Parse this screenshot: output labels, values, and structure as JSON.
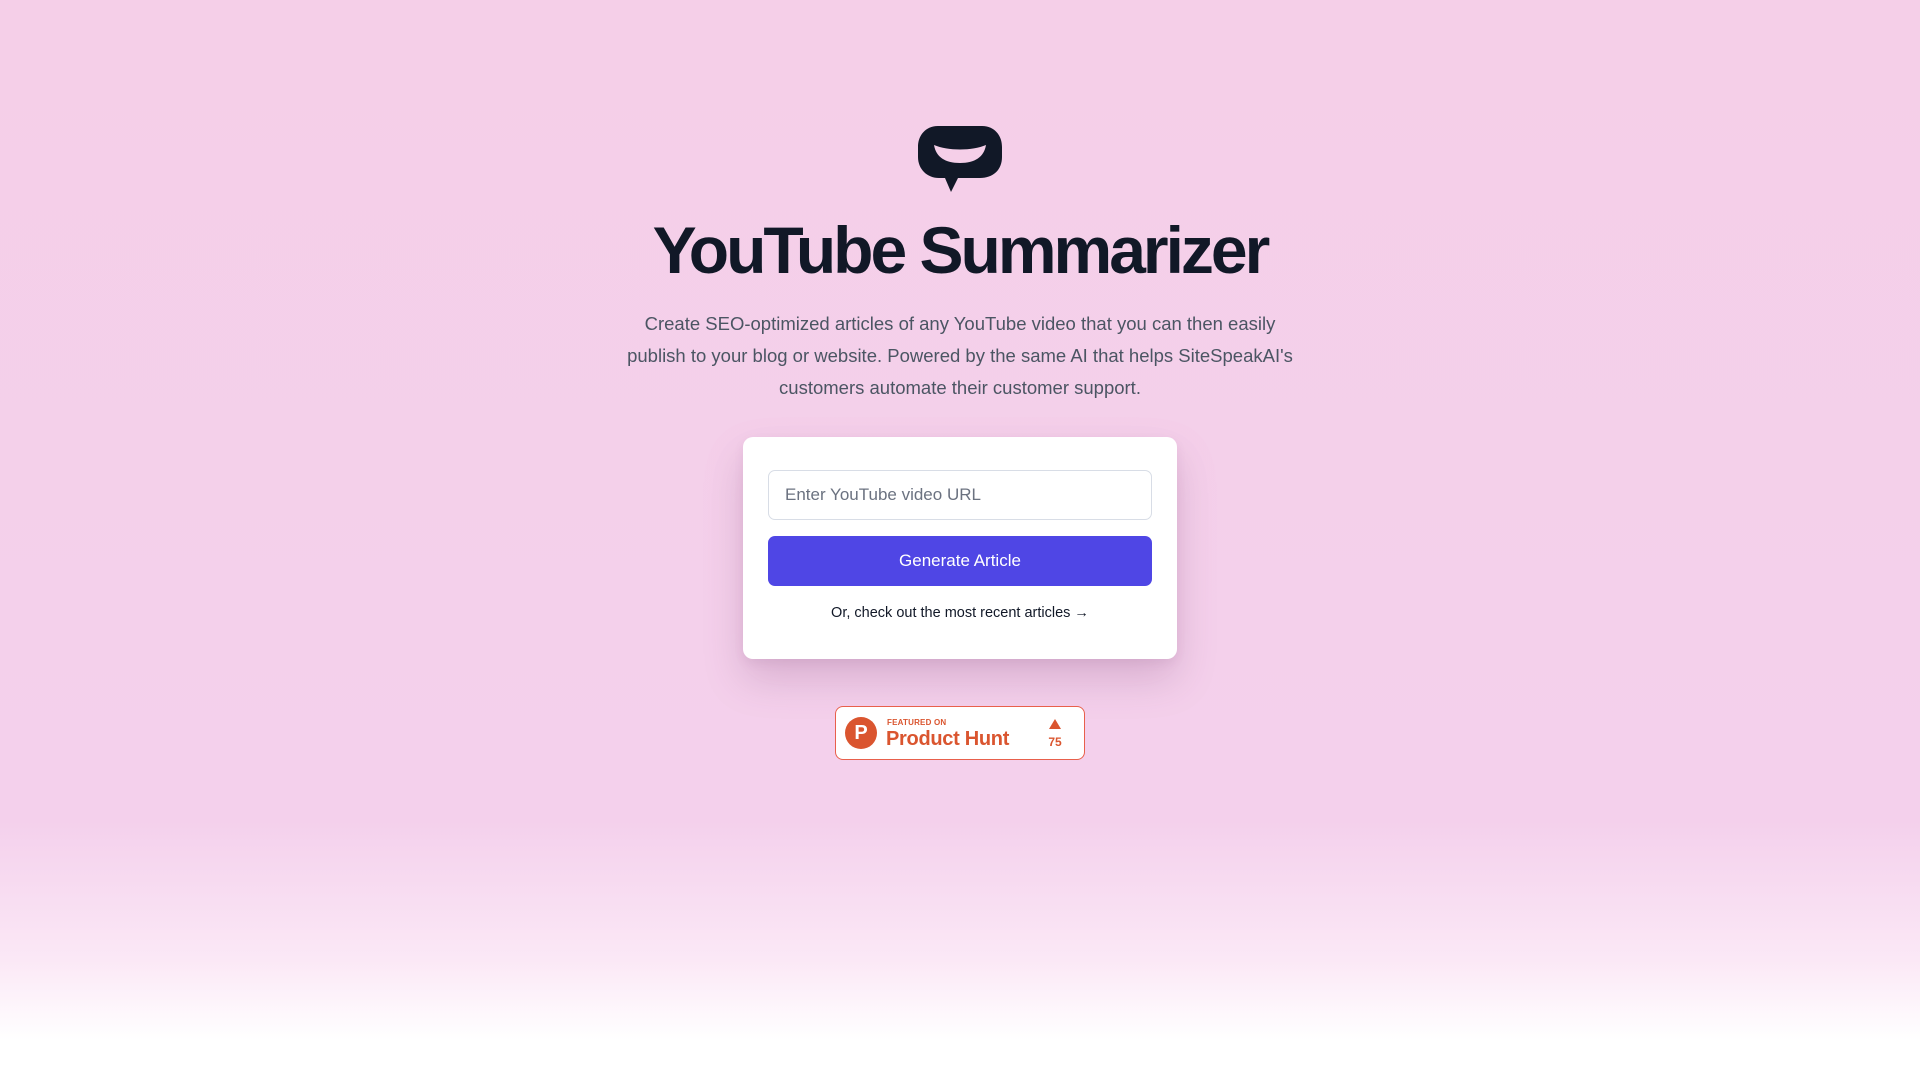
{
  "header": {
    "logo_icon": "speech-bubble-icon",
    "title": "YouTube Summarizer",
    "description": "Create SEO-optimized articles of any YouTube video that you can then easily publish to your blog or website. Powered by the same AI that helps SiteSpeakAI's customers automate their customer support."
  },
  "form": {
    "url_placeholder": "Enter YouTube video URL",
    "url_value": "",
    "generate_label": "Generate Article",
    "recent_link_label": "Or, check out the most recent articles →"
  },
  "product_hunt": {
    "logo_letter": "P",
    "featured_label": "FEATURED ON",
    "name": "Product Hunt",
    "upvotes": "75",
    "brand_color": "#da552f"
  },
  "colors": {
    "accent": "#4f46e5",
    "background": "#f5cfe8",
    "title": "#111827"
  }
}
